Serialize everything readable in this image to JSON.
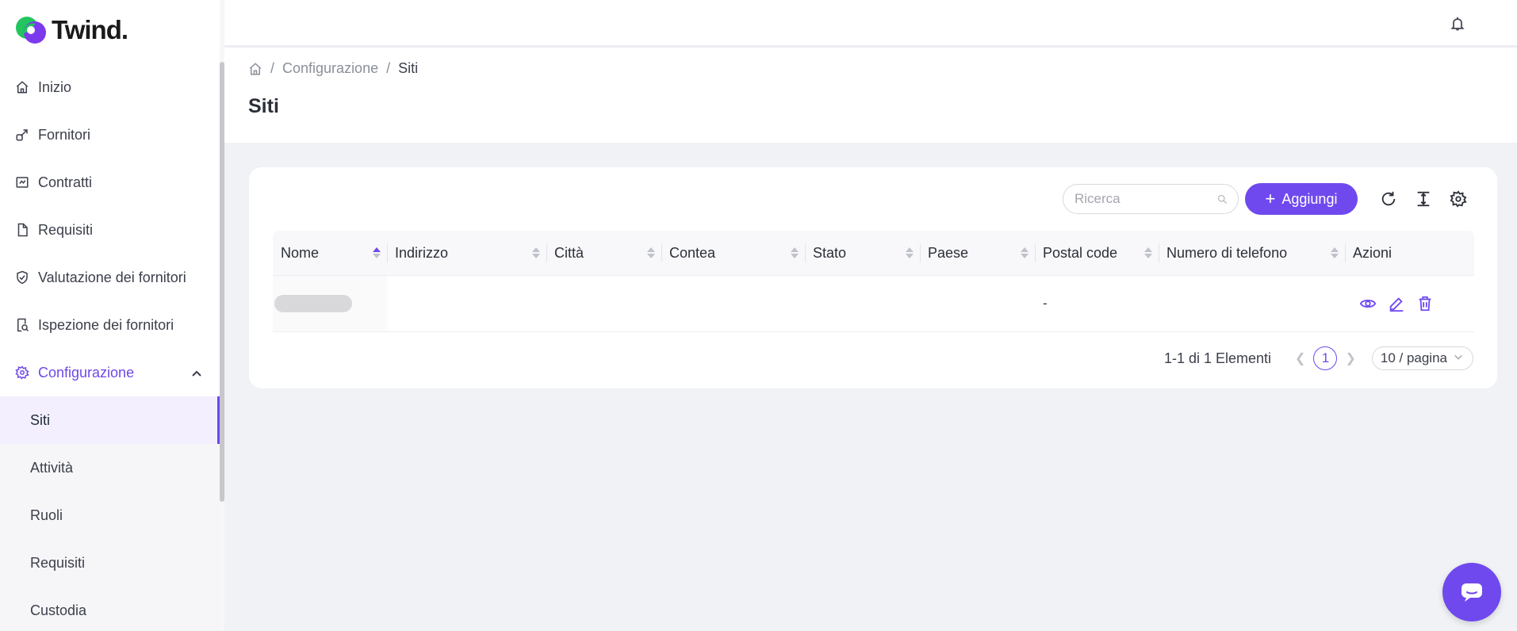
{
  "brand": {
    "name": "Twind.",
    "accent": "#6f49ee"
  },
  "sidebar": {
    "items": [
      {
        "label": "Inizio",
        "icon": "home-icon"
      },
      {
        "label": "Fornitori",
        "icon": "link-icon"
      },
      {
        "label": "Contratti",
        "icon": "contract-icon"
      },
      {
        "label": "Requisiti",
        "icon": "document-icon"
      },
      {
        "label": "Valutazione dei fornitori",
        "icon": "shield-check-icon"
      },
      {
        "label": "Ispezione dei fornitori",
        "icon": "inspection-icon"
      },
      {
        "label": "Configurazione",
        "icon": "gear-icon"
      }
    ],
    "sub_items": [
      {
        "label": "Siti"
      },
      {
        "label": "Attività"
      },
      {
        "label": "Ruoli"
      },
      {
        "label": "Requisiti"
      },
      {
        "label": "Custodia"
      }
    ]
  },
  "breadcrumb": {
    "section": "Configurazione",
    "current": "Siti",
    "separator": "/"
  },
  "page": {
    "title": "Siti"
  },
  "toolbar": {
    "search_placeholder": "Ricerca",
    "add_label": "Aggiungi"
  },
  "table": {
    "columns": [
      "Nome",
      "Indirizzo",
      "Città",
      "Contea",
      "Stato",
      "Paese",
      "Postal code",
      "Numero di telefono",
      "Azioni"
    ],
    "rows": [
      {
        "nome": "",
        "indirizzo": "",
        "citta": "",
        "contea": "",
        "stato": "",
        "paese": "",
        "postal_code": "-",
        "telefono": ""
      }
    ]
  },
  "pagination": {
    "total_text": "1-1 di 1 Elementi",
    "current_page": "1",
    "page_size": "10 / pagina"
  }
}
